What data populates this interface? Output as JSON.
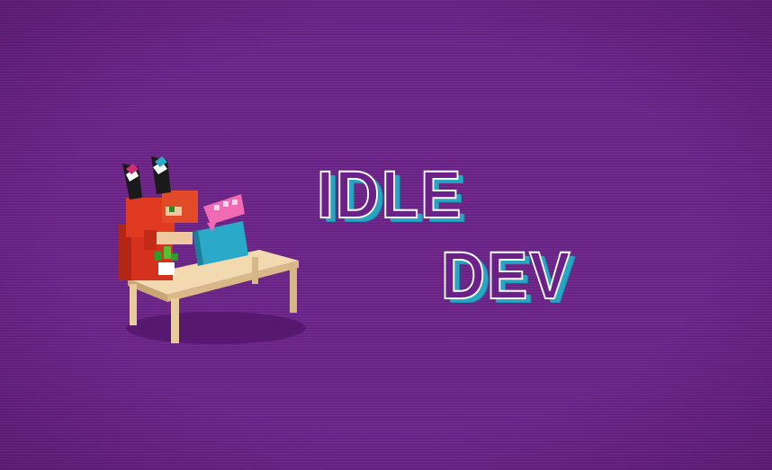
{
  "title": {
    "line1": "IDLE",
    "line2": "DEV"
  },
  "colors": {
    "background": "#6b2288",
    "title_outline": "#ffffff",
    "title_shadow": "#27a6c3"
  },
  "icons": {
    "mascot": "dev-mascot-icon"
  }
}
